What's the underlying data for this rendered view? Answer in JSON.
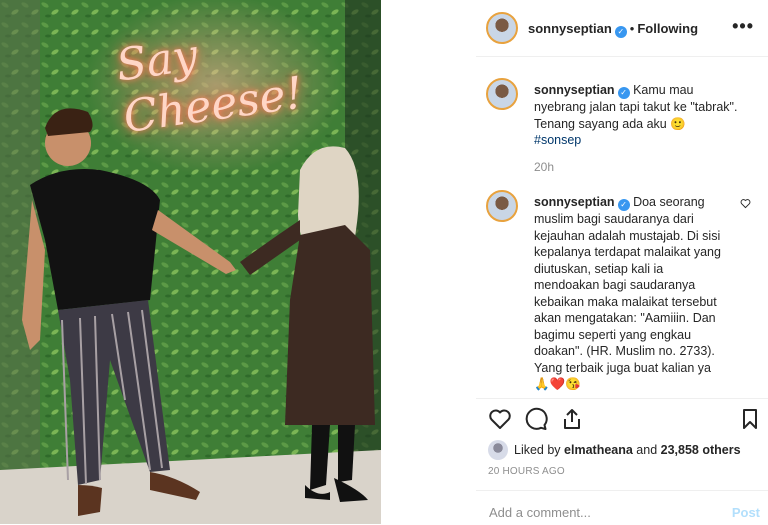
{
  "post_header": {
    "username": "sonnyseptian",
    "separator": "•",
    "follow_status": "Following",
    "more_label": "•••"
  },
  "photo": {
    "neon_sign_text": "Say Cheese!"
  },
  "caption": {
    "username": "sonnyseptian",
    "text": "Kamu mau nyebrang jalan tapi takut ke \"tabrak\". Tenang sayang ada aku 🙂",
    "hashtag": "#sonsep",
    "time": "20h"
  },
  "comments": [
    {
      "username": "sonnyseptian",
      "text": "Doa seorang muslim bagi saudaranya dari kejauhan adalah mustajab. Di sisi kepalanya terdapat malaikat yang diutuskan, setiap kali ia mendoakan bagi saudaranya kebaikan maka malaikat tersebut akan mengatakan: \"Aamiiin. Dan bagimu seperti yang engkau doakan\". (HR. Muslim no. 2733). Yang terbaik juga buat kalian ya",
      "emoji_line": "🙏❤️😘"
    }
  ],
  "likes": {
    "prefix": "Liked by ",
    "first_user": "elmatheana",
    "middle": " and ",
    "others": "23,858 others"
  },
  "timestamp": "20 HOURS AGO",
  "add_comment": {
    "placeholder": "Add a comment...",
    "post_label": "Post"
  },
  "icons": [
    "heart-icon",
    "comment-icon",
    "share-icon",
    "bookmark-icon",
    "verified-badge-icon",
    "more-options-icon"
  ],
  "colors": {
    "link": "#00376b",
    "verified": "#3897f0",
    "muted": "#8e8e8e",
    "post_disabled": "#b2dffc",
    "neon": "#ff8f73",
    "wall_green": "#3c7a35"
  }
}
